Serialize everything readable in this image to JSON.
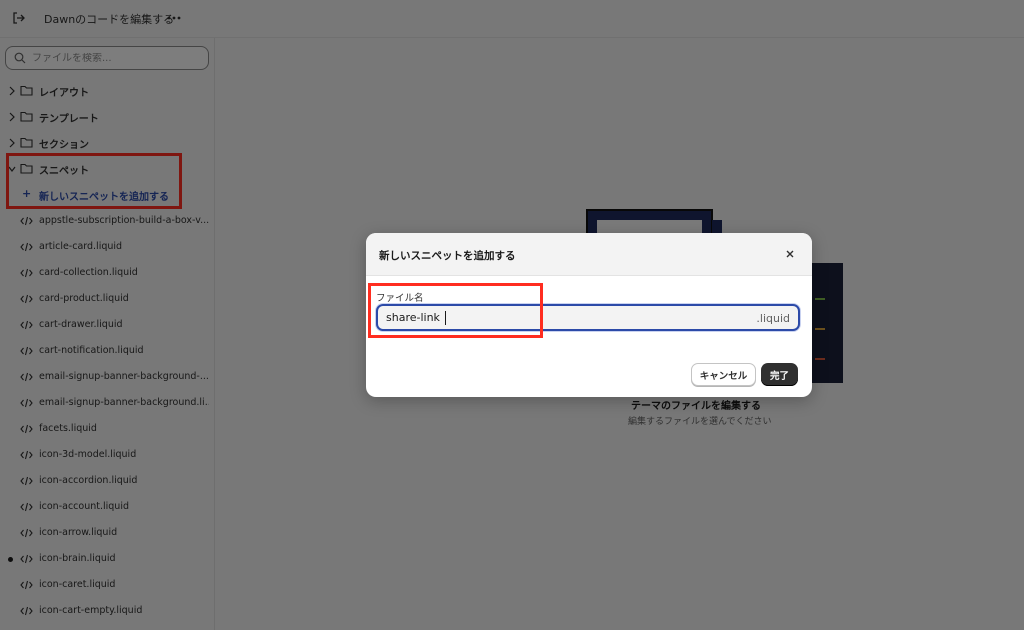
{
  "topbar": {
    "title": "Dawnのコードを編集する",
    "exit_icon": "exit-icon",
    "more_icon": "more-horizontal-icon"
  },
  "sidebar": {
    "search_placeholder": "ファイルを検索...",
    "folders": [
      {
        "label": "レイアウト",
        "expanded": false
      },
      {
        "label": "テンプレート",
        "expanded": false
      },
      {
        "label": "セクション",
        "expanded": false
      },
      {
        "label": "スニペット",
        "expanded": true
      }
    ],
    "add_snippet": {
      "plus": "+",
      "label": "新しいスニペットを追加する"
    },
    "files": [
      "appstle-subscription-build-a-box-v...",
      "article-card.liquid",
      "card-collection.liquid",
      "card-product.liquid",
      "cart-drawer.liquid",
      "cart-notification.liquid",
      "email-signup-banner-background-...",
      "email-signup-banner-background.li...",
      "facets.liquid",
      "icon-3d-model.liquid",
      "icon-accordion.liquid",
      "icon-account.liquid",
      "icon-arrow.liquid",
      "icon-brain.liquid",
      "icon-caret.liquid",
      "icon-cart-empty.liquid"
    ],
    "unsaved_file": "icon-brain.liquid"
  },
  "empty_state": {
    "title": "テーマのファイルを編集する",
    "subtitle": "編集するファイルを選んでください"
  },
  "modal": {
    "title": "新しいスニペットを追加する",
    "field_label": "ファイル名",
    "field_value": "share-link",
    "field_suffix": ".liquid",
    "cancel_label": "キャンセル",
    "done_label": "完了"
  },
  "colors": {
    "highlight": "#ff2d20",
    "accent": "#2c4aa8",
    "primary_button": "#303030"
  }
}
